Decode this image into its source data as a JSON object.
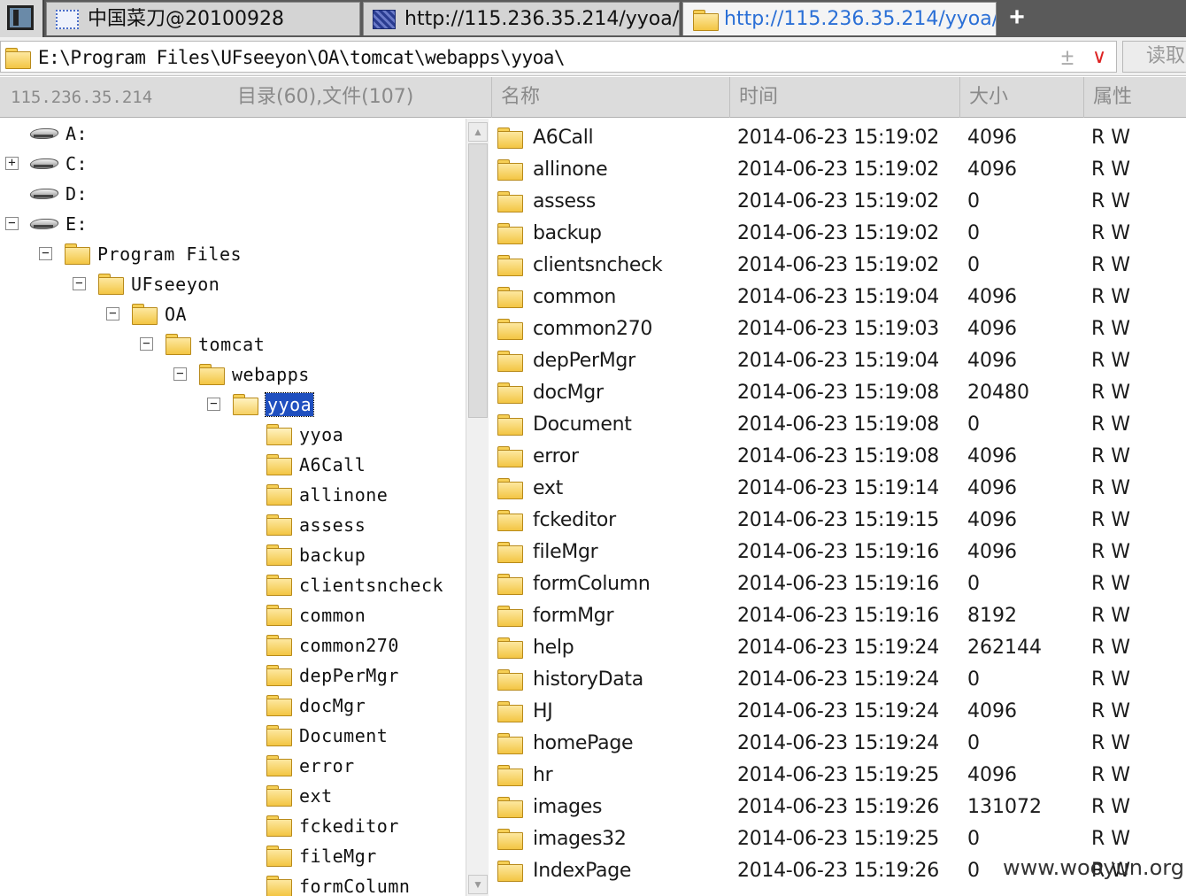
{
  "tabs": [
    {
      "label": "中国菜刀@20100928"
    },
    {
      "label": "http://115.236.35.214/yyoa/..."
    },
    {
      "label": "http://115.236.35.214/yyoa/..."
    }
  ],
  "new_tab_label": "+",
  "address": {
    "path": "E:\\Program Files\\UFseeyon\\OA\\tomcat\\webapps\\yyoa\\",
    "read_button": "读取"
  },
  "header": {
    "server": "115.236.35.214",
    "counts": "目录(60),文件(107)",
    "columns": {
      "name": "名称",
      "time": "时间",
      "size": "大小",
      "attr": "属性"
    }
  },
  "tree": [
    {
      "label": "A:",
      "type": "drive",
      "toggle": ""
    },
    {
      "label": "C:",
      "type": "drive",
      "toggle": "+"
    },
    {
      "label": "D:",
      "type": "drive",
      "toggle": ""
    },
    {
      "label": "E:",
      "type": "drive",
      "toggle": "−"
    },
    {
      "label": "Program Files",
      "type": "folder",
      "toggle": "−"
    },
    {
      "label": "UFseeyon",
      "type": "folder",
      "toggle": "−"
    },
    {
      "label": "OA",
      "type": "folder",
      "toggle": "−"
    },
    {
      "label": "tomcat",
      "type": "folder",
      "toggle": "−"
    },
    {
      "label": "webapps",
      "type": "folder",
      "toggle": "−"
    },
    {
      "label": "yyoa",
      "type": "folder-open",
      "toggle": "−",
      "selected": true
    },
    {
      "label": "yyoa",
      "type": "folder-open",
      "toggle": ""
    },
    {
      "label": "A6Call",
      "type": "folder",
      "toggle": ""
    },
    {
      "label": "allinone",
      "type": "folder",
      "toggle": ""
    },
    {
      "label": "assess",
      "type": "folder",
      "toggle": ""
    },
    {
      "label": "backup",
      "type": "folder",
      "toggle": ""
    },
    {
      "label": "clientsncheck",
      "type": "folder",
      "toggle": ""
    },
    {
      "label": "common",
      "type": "folder",
      "toggle": ""
    },
    {
      "label": "common270",
      "type": "folder",
      "toggle": ""
    },
    {
      "label": "depPerMgr",
      "type": "folder",
      "toggle": ""
    },
    {
      "label": "docMgr",
      "type": "folder",
      "toggle": ""
    },
    {
      "label": "Document",
      "type": "folder",
      "toggle": ""
    },
    {
      "label": "error",
      "type": "folder",
      "toggle": ""
    },
    {
      "label": "ext",
      "type": "folder",
      "toggle": ""
    },
    {
      "label": "fckeditor",
      "type": "folder",
      "toggle": ""
    },
    {
      "label": "fileMgr",
      "type": "folder",
      "toggle": ""
    },
    {
      "label": "formColumn",
      "type": "folder",
      "toggle": ""
    }
  ],
  "tree_depth": [
    0,
    0,
    0,
    0,
    1,
    2,
    3,
    4,
    5,
    6,
    7,
    7,
    7,
    7,
    7,
    7,
    7,
    7,
    7,
    7,
    7,
    7,
    7,
    7,
    7,
    7
  ],
  "files": [
    {
      "name": "A6Call",
      "time": "2014-06-23 15:19:02",
      "size": "4096",
      "attr": "R W"
    },
    {
      "name": "allinone",
      "time": "2014-06-23 15:19:02",
      "size": "4096",
      "attr": "R W"
    },
    {
      "name": "assess",
      "time": "2014-06-23 15:19:02",
      "size": "0",
      "attr": "R W"
    },
    {
      "name": "backup",
      "time": "2014-06-23 15:19:02",
      "size": "0",
      "attr": "R W"
    },
    {
      "name": "clientsncheck",
      "time": "2014-06-23 15:19:02",
      "size": "0",
      "attr": "R W"
    },
    {
      "name": "common",
      "time": "2014-06-23 15:19:04",
      "size": "4096",
      "attr": "R W"
    },
    {
      "name": "common270",
      "time": "2014-06-23 15:19:03",
      "size": "4096",
      "attr": "R W"
    },
    {
      "name": "depPerMgr",
      "time": "2014-06-23 15:19:04",
      "size": "4096",
      "attr": "R W"
    },
    {
      "name": "docMgr",
      "time": "2014-06-23 15:19:08",
      "size": "20480",
      "attr": "R W"
    },
    {
      "name": "Document",
      "time": "2014-06-23 15:19:08",
      "size": "0",
      "attr": "R W"
    },
    {
      "name": "error",
      "time": "2014-06-23 15:19:08",
      "size": "4096",
      "attr": "R W"
    },
    {
      "name": "ext",
      "time": "2014-06-23 15:19:14",
      "size": "4096",
      "attr": "R W"
    },
    {
      "name": "fckeditor",
      "time": "2014-06-23 15:19:15",
      "size": "4096",
      "attr": "R W"
    },
    {
      "name": "fileMgr",
      "time": "2014-06-23 15:19:16",
      "size": "4096",
      "attr": "R W"
    },
    {
      "name": "formColumn",
      "time": "2014-06-23 15:19:16",
      "size": "0",
      "attr": "R W"
    },
    {
      "name": "formMgr",
      "time": "2014-06-23 15:19:16",
      "size": "8192",
      "attr": "R W"
    },
    {
      "name": "help",
      "time": "2014-06-23 15:19:24",
      "size": "262144",
      "attr": "R W"
    },
    {
      "name": "historyData",
      "time": "2014-06-23 15:19:24",
      "size": "0",
      "attr": "R W"
    },
    {
      "name": "HJ",
      "time": "2014-06-23 15:19:24",
      "size": "4096",
      "attr": "R W"
    },
    {
      "name": "homePage",
      "time": "2014-06-23 15:19:24",
      "size": "0",
      "attr": "R W"
    },
    {
      "name": "hr",
      "time": "2014-06-23 15:19:25",
      "size": "4096",
      "attr": "R W"
    },
    {
      "name": "images",
      "time": "2014-06-23 15:19:26",
      "size": "131072",
      "attr": "R W"
    },
    {
      "name": "images32",
      "time": "2014-06-23 15:19:25",
      "size": "0",
      "attr": "R W"
    },
    {
      "name": "IndexPage",
      "time": "2014-06-23 15:19:26",
      "size": "0",
      "attr": "R W"
    }
  ],
  "watermark": "www.wooyun.org",
  "colors": {
    "accent": "#2a6fd6",
    "selection": "#1f4fbf",
    "folder": "#f3c543"
  }
}
